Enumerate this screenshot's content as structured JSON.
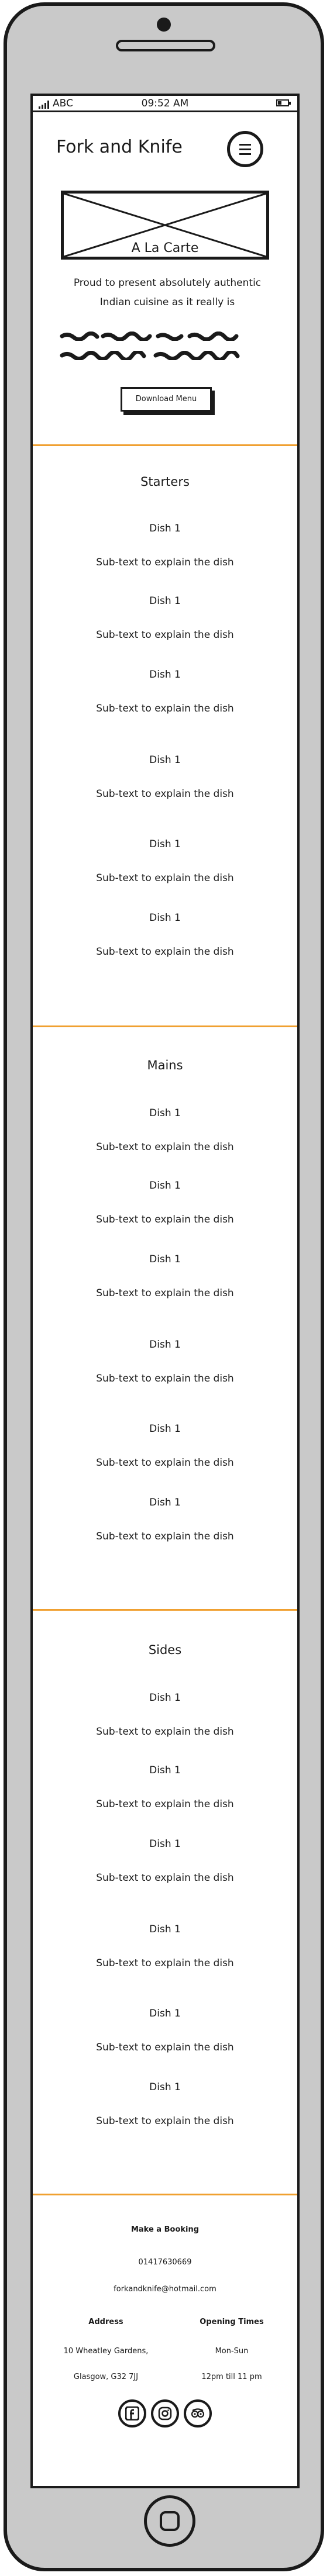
{
  "status": {
    "carrier": "ABC",
    "time": "09:52 AM"
  },
  "header": {
    "brand": "Fork and Knife"
  },
  "hero": {
    "caption": "A La Carte",
    "intro_line1": "Proud to present absolutely authentic",
    "intro_line2": "Indian cuisine as it really is",
    "download_label": "Download Menu"
  },
  "sections": [
    {
      "title": "Starters",
      "dishes": [
        {
          "name": "Dish 1",
          "sub": "Sub-text to explain the dish"
        },
        {
          "name": "Dish 1",
          "sub": "Sub-text to explain the dish"
        },
        {
          "name": "Dish 1",
          "sub": "Sub-text to explain the dish"
        },
        {
          "name": "Dish 1",
          "sub": "Sub-text to explain the dish"
        },
        {
          "name": "Dish 1",
          "sub": "Sub-text to explain the dish"
        },
        {
          "name": "Dish 1",
          "sub": "Sub-text to explain the dish"
        }
      ]
    },
    {
      "title": "Mains",
      "dishes": [
        {
          "name": "Dish 1",
          "sub": "Sub-text to explain the dish"
        },
        {
          "name": "Dish 1",
          "sub": "Sub-text to explain the dish"
        },
        {
          "name": "Dish 1",
          "sub": "Sub-text to explain the dish"
        },
        {
          "name": "Dish 1",
          "sub": "Sub-text to explain the dish"
        },
        {
          "name": "Dish 1",
          "sub": "Sub-text to explain the dish"
        },
        {
          "name": "Dish 1",
          "sub": "Sub-text to explain the dish"
        }
      ]
    },
    {
      "title": "Sides",
      "dishes": [
        {
          "name": "Dish 1",
          "sub": "Sub-text to explain the dish"
        },
        {
          "name": "Dish 1",
          "sub": "Sub-text to explain the dish"
        },
        {
          "name": "Dish 1",
          "sub": "Sub-text to explain the dish"
        },
        {
          "name": "Dish 1",
          "sub": "Sub-text to explain the dish"
        },
        {
          "name": "Dish 1",
          "sub": "Sub-text to explain the dish"
        },
        {
          "name": "Dish 1",
          "sub": "Sub-text to explain the dish"
        }
      ]
    }
  ],
  "footer": {
    "booking_title": "Make a Booking",
    "phone": "01417630669",
    "email": "forkandknife@hotmail.com",
    "address_title": "Address",
    "address_line1": "10 Wheatley Gardens,",
    "address_line2": "Glasgow, G32 7JJ",
    "hours_title": "Opening Times",
    "hours_days": "Mon-Sun",
    "hours_time": "12pm till 11 pm",
    "social_icons": [
      "facebook-icon",
      "instagram-icon",
      "tripadvisor-icon"
    ]
  },
  "colors": {
    "divider": "#f0a030",
    "ink": "#1a1a1a",
    "frame": "#c9c9c9"
  }
}
